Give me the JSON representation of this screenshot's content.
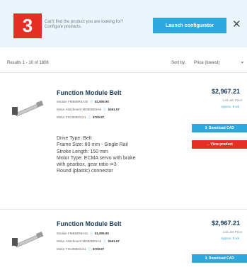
{
  "banner": {
    "badge": "3",
    "text_line1": "Can't find the product you are looking for?",
    "text_line2": "Configure products.",
    "config_button": "Launch configurator",
    "close": "✕"
  },
  "toolbar": {
    "results": "Results 1 - 10 of 1808",
    "sort_label": "Sort by:",
    "sort_value": "Price (lowest)",
    "chevron": "⌄"
  },
  "products": [
    {
      "title": "Function Module Belt",
      "specs": [
        {
          "label": "Module FMB68R6A30",
          "value": "$1,805.90"
        },
        {
          "label": "Motor Attachment MDB0BE9A6",
          "value": "$461.67"
        },
        {
          "label": "Motor FSC0ME01S1",
          "value": "$700.97"
        }
      ],
      "description": [
        "Drive Type: Belt",
        "Frame Size: 80 mm - Single Rail",
        "Stroke Length: 150 mm",
        "Motor Type: ECMA servo with brake",
        "with gearbox, gear ratio i=3",
        "Round (plastic) connector"
      ],
      "price": "$2,967.21",
      "price_sub": "List unit Price",
      "price_sub2": "Approx. 8 wk",
      "download": "⬇  Download CAD",
      "view": "→  View product"
    },
    {
      "title": "Function Module Belt",
      "specs": [
        {
          "label": "Module FMB68R6A31",
          "value": "$1,805.90"
        },
        {
          "label": "Motor Attachment MDB0BE9A6",
          "value": "$461.67"
        },
        {
          "label": "Motor FSC0ME01S1",
          "value": "$700.97"
        }
      ],
      "price": "$2,967.21",
      "price_sub": "List unit Price",
      "price_sub2": "Approx. 8 wk",
      "download": "⬇  Download CAD"
    }
  ]
}
